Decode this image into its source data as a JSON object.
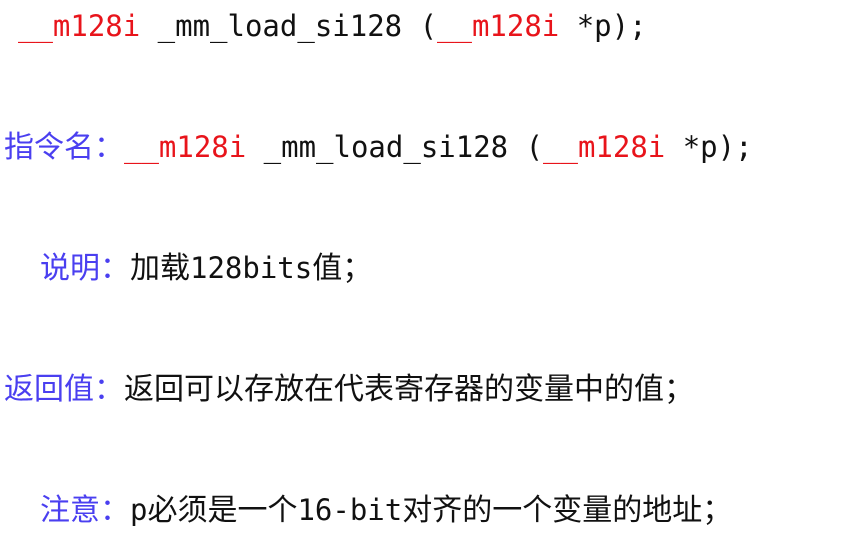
{
  "signature": {
    "ret_type": "__m128i",
    "func_name": " _mm_load_si128 (",
    "param_type": "__m128i",
    "param_rest": " *p);"
  },
  "instruction": {
    "label": "指令名：",
    "ret_type": "__m128i",
    "func_name": " _mm_load_si128 (",
    "param_type": "__m128i",
    "param_rest": " *p);"
  },
  "description": {
    "label": "说明：",
    "text_pre": "加载",
    "text_mono": "128bits",
    "text_post": "值；"
  },
  "return_value": {
    "label": "返回值：",
    "text": "返回可以存放在代表寄存器的变量中的值；"
  },
  "note": {
    "label": "注意：",
    "text_p": "p",
    "text_1": "必须是一个",
    "text_mono": "16-bit",
    "text_2": "对齐的一个变量的地址；"
  },
  "colors": {
    "type_red": "#e8141b",
    "label_blue": "#4a3ff0",
    "text_dark": "#111111"
  }
}
